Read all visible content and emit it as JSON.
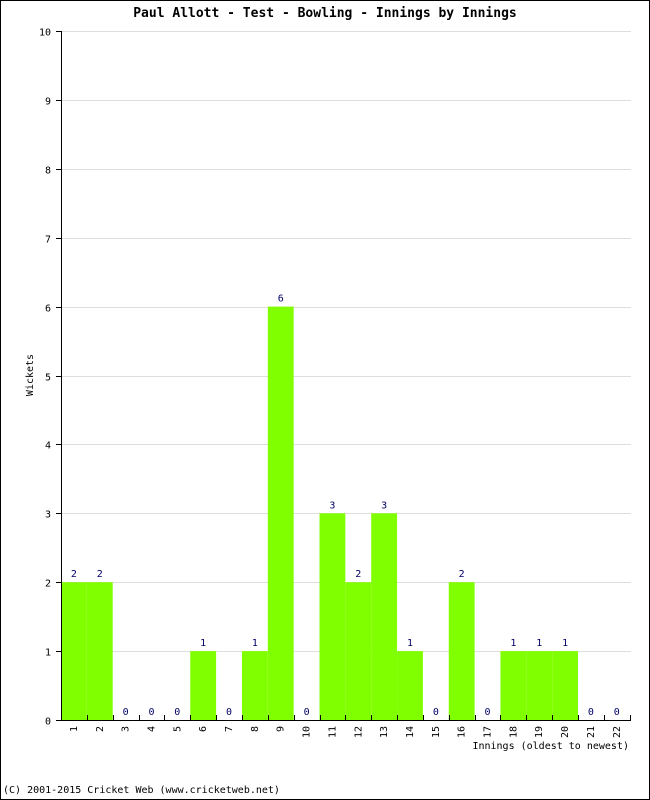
{
  "chart_data": {
    "type": "bar",
    "title": "Paul Allott - Test - Bowling - Innings by Innings",
    "xlabel": "Innings (oldest to newest)",
    "ylabel": "Wickets",
    "ylim": [
      0,
      10
    ],
    "yticks": [
      "0",
      "1",
      "2",
      "3",
      "4",
      "5",
      "6",
      "7",
      "8",
      "9",
      "10"
    ],
    "categories": [
      "1",
      "2",
      "3",
      "4",
      "5",
      "6",
      "7",
      "8",
      "9",
      "10",
      "11",
      "12",
      "13",
      "14",
      "15",
      "16",
      "17",
      "18",
      "19",
      "20",
      "21",
      "22"
    ],
    "values": [
      2,
      2,
      0,
      0,
      0,
      1,
      0,
      1,
      6,
      0,
      3,
      2,
      3,
      1,
      0,
      2,
      0,
      1,
      1,
      1,
      0,
      0
    ],
    "grid": true,
    "bar_color": "#80ff00",
    "gridline_color": "#dddddd",
    "label_color": "#000066"
  },
  "footer": "(C) 2001-2015 Cricket Web (www.cricketweb.net)"
}
